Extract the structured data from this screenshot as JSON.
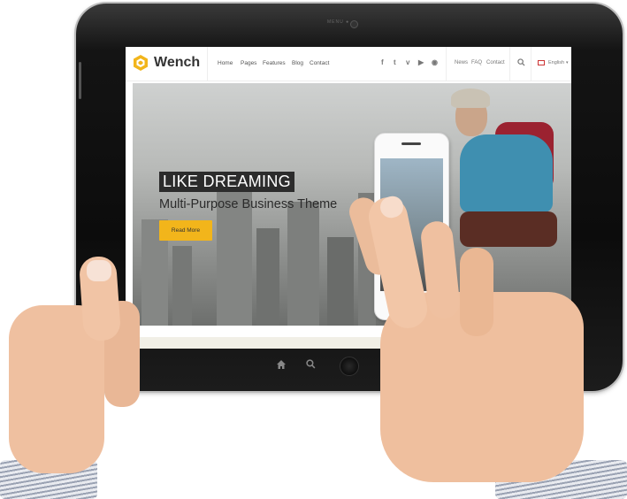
{
  "tablet": {
    "camera_label": "MENU  ● ◦",
    "colors": {
      "bezel": "#0c0c0c",
      "frame": "#bdbdbd"
    }
  },
  "site": {
    "brand": "Wench",
    "accent": "#f2b51b",
    "nav": [
      "Home",
      "Pages",
      "Features",
      "Blog",
      "Contact"
    ],
    "social": [
      {
        "name": "facebook-icon",
        "glyph": "f"
      },
      {
        "name": "twitter-icon",
        "glyph": "t"
      },
      {
        "name": "vimeo-icon",
        "glyph": "v"
      },
      {
        "name": "youtube-icon",
        "glyph": "▶"
      },
      {
        "name": "rss-icon",
        "glyph": "◉"
      }
    ],
    "util_links": [
      "News",
      "FAQ",
      "Contact"
    ],
    "language": "English",
    "hero": {
      "title": "LIKE DREAMING",
      "subtitle": "Multi-Purpose Business Theme",
      "button": "Read More"
    }
  }
}
